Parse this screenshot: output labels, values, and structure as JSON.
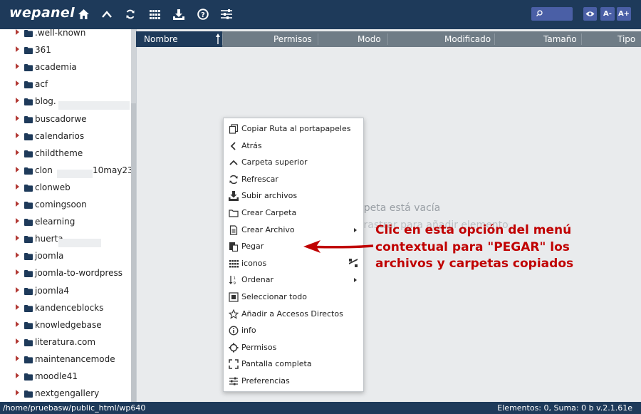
{
  "app": {
    "logo": "wepanel"
  },
  "toolbar": {
    "icons": [
      "home-icon",
      "up-arrow-icon",
      "refresh-icon",
      "grid-icon",
      "upload-icon",
      "help-icon",
      "settings-icon"
    ],
    "search_placeholder": "",
    "font_minus": "A-",
    "font_plus": "A+"
  },
  "sidebar": {
    "items": [
      {
        "label": ".well-known"
      },
      {
        "label": "361"
      },
      {
        "label": "academia"
      },
      {
        "label": "acf"
      },
      {
        "label": "blog."
      },
      {
        "label": "buscadorwe"
      },
      {
        "label": "calendarios"
      },
      {
        "label": "childtheme"
      },
      {
        "label": "clon",
        "suffix": "10may23"
      },
      {
        "label": "clonweb"
      },
      {
        "label": "comingsoon"
      },
      {
        "label": "elearning"
      },
      {
        "label": "huerta"
      },
      {
        "label": "joomla"
      },
      {
        "label": "joomla-to-wordpress"
      },
      {
        "label": "joomla4"
      },
      {
        "label": "kandenceblocks"
      },
      {
        "label": "knowledgebase"
      },
      {
        "label": "literatura.com"
      },
      {
        "label": "maintenancemode"
      },
      {
        "label": "moodle41"
      },
      {
        "label": "nextgengallery"
      }
    ]
  },
  "columns": {
    "name": "Nombre",
    "permisos": "Permisos",
    "modo": "Modo",
    "modificado": "Modificado",
    "tamano": "Tamaño",
    "tipo": "Tipo"
  },
  "empty_state": {
    "line1": "rpeta está vacía",
    "line2": "rrastrar para añadir elementos"
  },
  "context_menu": {
    "items": [
      {
        "label": "Copiar Ruta al portapapeles",
        "icon": "copy-icon"
      },
      {
        "label": "Atrás",
        "icon": "back-icon"
      },
      {
        "label": "Carpeta superior",
        "icon": "up-icon"
      },
      {
        "label": "Refrescar",
        "icon": "refresh-icon"
      },
      {
        "label": "Subir archivos",
        "icon": "upload-icon"
      },
      {
        "label": "Crear Carpeta",
        "icon": "folder-icon"
      },
      {
        "label": "Crear Archivo",
        "icon": "file-icon",
        "submenu": true
      },
      {
        "label": "Pegar",
        "icon": "paste-icon"
      },
      {
        "label": "iconos",
        "icon": "grid-icon"
      },
      {
        "label": "Ordenar",
        "icon": "sort-icon",
        "submenu": true
      },
      {
        "label": "Seleccionar todo",
        "icon": "select-all-icon"
      },
      {
        "label": "Añadir a Accesos Directos",
        "icon": "star-icon"
      },
      {
        "label": "info",
        "icon": "info-icon"
      },
      {
        "label": "Permisos",
        "icon": "permissions-icon"
      },
      {
        "label": "Pantalla completa",
        "icon": "fullscreen-icon"
      },
      {
        "label": "Preferencias",
        "icon": "preferences-icon"
      }
    ]
  },
  "annotation": {
    "lines": [
      "Clic en esta opción del menú",
      "contextual para \"PEGAR\" los",
      "archivos y carpetas copiados"
    ],
    "color": "#c00000"
  },
  "status": {
    "path": "/home/pruebasw/public_html/wp640",
    "info": "Elementos: 0, Suma: 0 b v.2.1.61e"
  },
  "colors": {
    "topbar": "#1e3a5a",
    "accent": "#4a5fa6",
    "folder": "#1e3a5a",
    "arrow": "#b23a35"
  }
}
